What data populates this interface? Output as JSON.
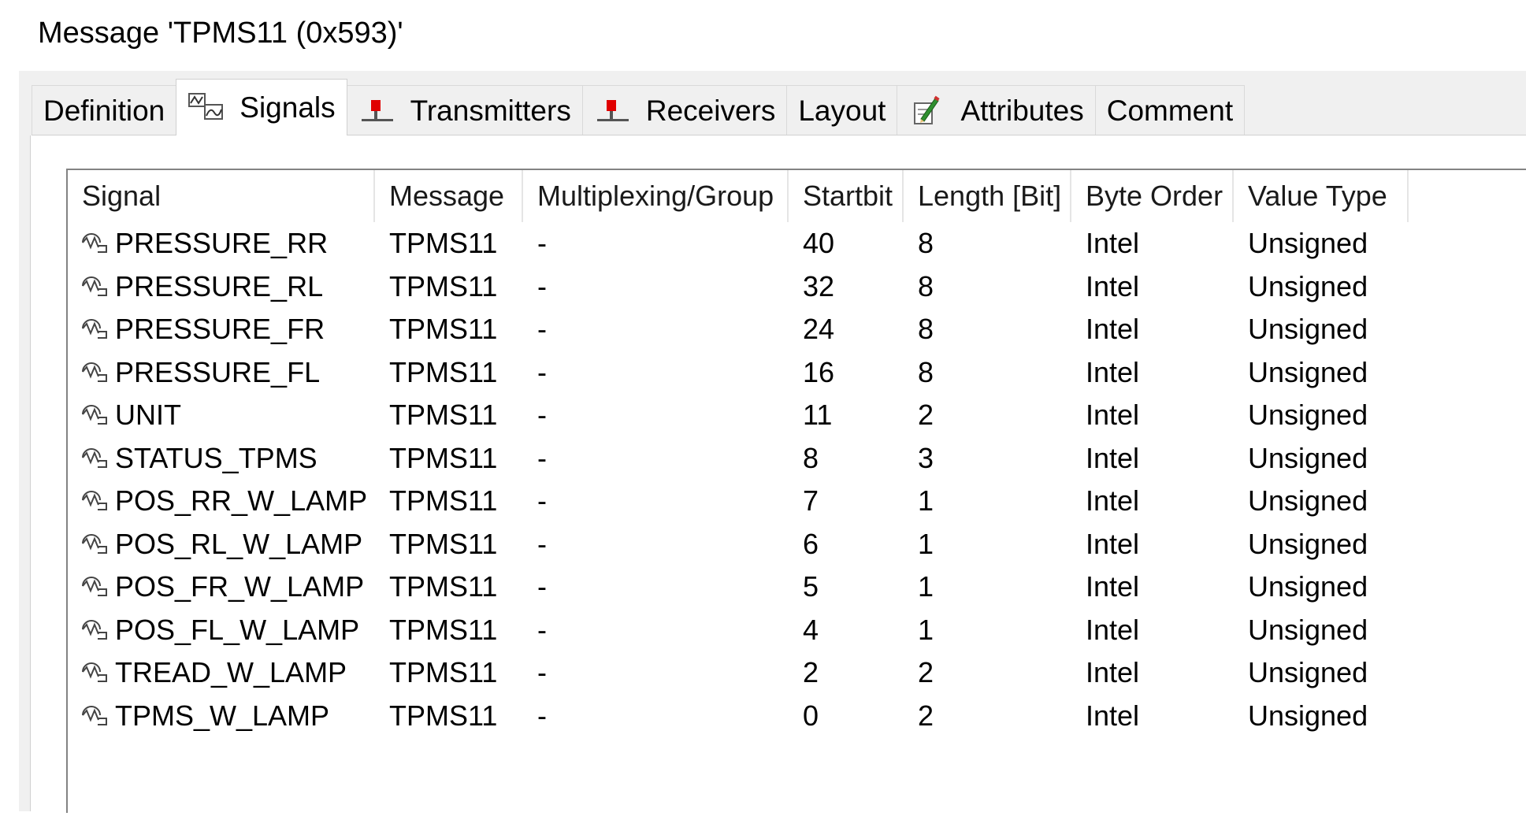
{
  "window": {
    "title": "Message 'TPMS11 (0x593)'"
  },
  "tabs": [
    {
      "label": "Definition",
      "icon": ""
    },
    {
      "label": "Signals",
      "icon": "signal-icon"
    },
    {
      "label": "Transmitters",
      "icon": "transmitter-icon"
    },
    {
      "label": "Receivers",
      "icon": "receiver-icon"
    },
    {
      "label": "Layout",
      "icon": ""
    },
    {
      "label": "Attributes",
      "icon": "attributes-pencil-icon"
    },
    {
      "label": "Comment",
      "icon": ""
    }
  ],
  "active_tab": "Signals",
  "table": {
    "columns": [
      "Signal",
      "Message",
      "Multiplexing/Group",
      "Startbit",
      "Length [Bit]",
      "Byte Order",
      "Value Type"
    ],
    "rows": [
      [
        "PRESSURE_RR",
        "TPMS11",
        "-",
        "40",
        "8",
        "Intel",
        "Unsigned"
      ],
      [
        "PRESSURE_RL",
        "TPMS11",
        "-",
        "32",
        "8",
        "Intel",
        "Unsigned"
      ],
      [
        "PRESSURE_FR",
        "TPMS11",
        "-",
        "24",
        "8",
        "Intel",
        "Unsigned"
      ],
      [
        "PRESSURE_FL",
        "TPMS11",
        "-",
        "16",
        "8",
        "Intel",
        "Unsigned"
      ],
      [
        "UNIT",
        "TPMS11",
        "-",
        "11",
        "2",
        "Intel",
        "Unsigned"
      ],
      [
        "STATUS_TPMS",
        "TPMS11",
        "-",
        "8",
        "3",
        "Intel",
        "Unsigned"
      ],
      [
        "POS_RR_W_LAMP",
        "TPMS11",
        "-",
        "7",
        "1",
        "Intel",
        "Unsigned"
      ],
      [
        "POS_RL_W_LAMP",
        "TPMS11",
        "-",
        "6",
        "1",
        "Intel",
        "Unsigned"
      ],
      [
        "POS_FR_W_LAMP",
        "TPMS11",
        "-",
        "5",
        "1",
        "Intel",
        "Unsigned"
      ],
      [
        "POS_FL_W_LAMP",
        "TPMS11",
        "-",
        "4",
        "1",
        "Intel",
        "Unsigned"
      ],
      [
        "TREAD_W_LAMP",
        "TPMS11",
        "-",
        "2",
        "2",
        "Intel",
        "Unsigned"
      ],
      [
        "TPMS_W_LAMP",
        "TPMS11",
        "-",
        "0",
        "2",
        "Intel",
        "Unsigned"
      ]
    ]
  },
  "colors": {
    "panel_bg": "#f0f0f0",
    "transmitter_red": "#e00000",
    "pencil_green": "#2f8f2f"
  }
}
